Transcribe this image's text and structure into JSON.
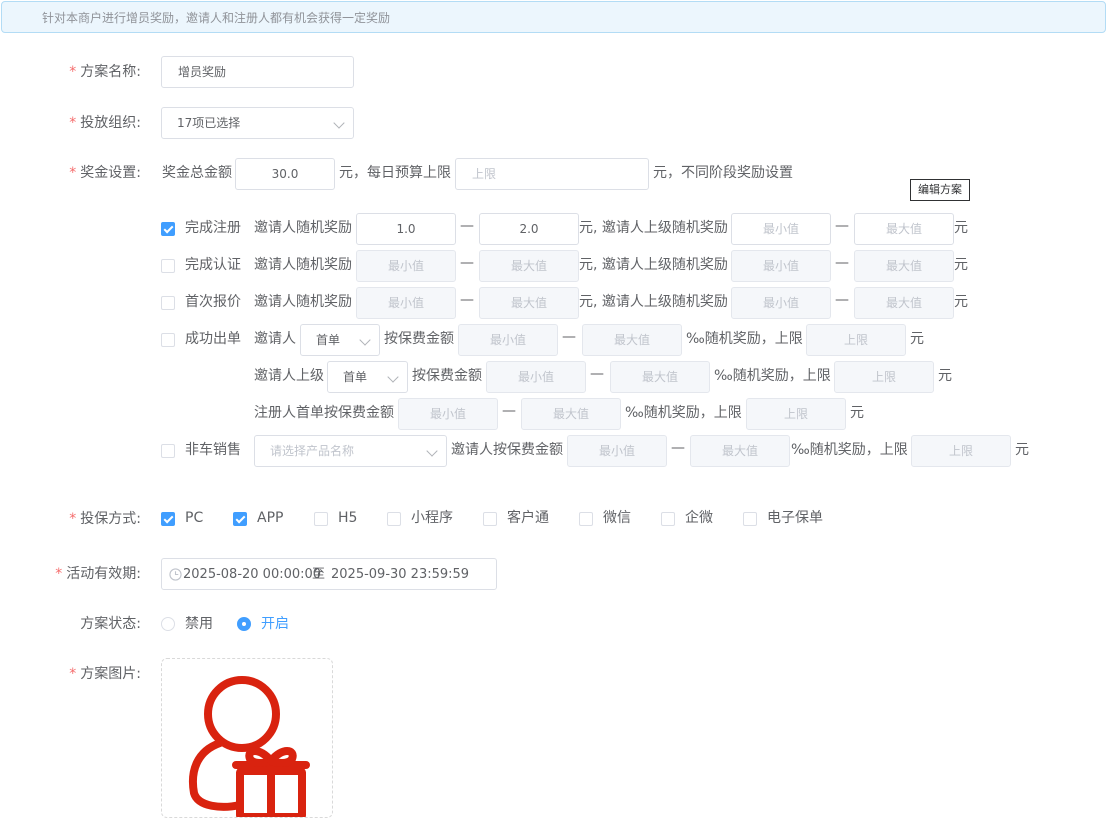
{
  "banner": "针对本商户进行增员奖励，邀请人和注册人都有机会获得一定奖励",
  "labels": {
    "plan_name": "方案名称:",
    "org": "投放组织:",
    "prize": "奖金设置:",
    "insure_method": "投保方式:",
    "period": "活动有效期:",
    "status": "方案状态:",
    "image": "方案图片:"
  },
  "required_mark": "*",
  "plan_name_value": "增员奖励",
  "org_value": "17项已选择",
  "prize": {
    "total_label": "奖金总金额",
    "total_value": "30.0",
    "daily_text": "元，每日预算上限",
    "daily_placeholder": "上限",
    "after_text": "元，不同阶段奖励设置",
    "tooltip": "编辑方案"
  },
  "common": {
    "dash": "—",
    "yuan": "元",
    "min_ph": "最小值",
    "max_ph": "最大值",
    "limit_ph": "上限",
    "inviter_random": "邀请人随机奖励",
    "yuan_superior_random": "元, 邀请人上级随机奖励",
    "by_premium": "按保费金额",
    "permil_random": "‰随机奖励，上限"
  },
  "stages": [
    {
      "label": "完成注册",
      "checked": true,
      "v1": "1.0",
      "v2": "2.0"
    },
    {
      "label": "完成认证",
      "checked": false
    },
    {
      "label": "首次报价",
      "checked": false
    }
  ],
  "deal": {
    "label": "成功出单",
    "inviter": "邀请人",
    "inviter_superior": "邀请人上级",
    "registrant": "注册人首单按保费金额",
    "select_value": "首单"
  },
  "nonauto": {
    "label": "非车销售",
    "select_placeholder": "请选择产品名称",
    "inviter_by_premium": "邀请人按保费金额"
  },
  "channels": [
    {
      "label": "PC",
      "checked": true
    },
    {
      "label": "APP",
      "checked": true
    },
    {
      "label": "H5",
      "checked": false
    },
    {
      "label": "小程序",
      "checked": false
    },
    {
      "label": "客户通",
      "checked": false
    },
    {
      "label": "微信",
      "checked": false
    },
    {
      "label": "企微",
      "checked": false
    },
    {
      "label": "电子保单",
      "checked": false
    }
  ],
  "period": {
    "start": "2025-08-20 00:00:00",
    "sep": "至",
    "end": "2025-09-30 23:59:59",
    "icon": "clock-icon"
  },
  "status_options": [
    {
      "label": "禁用",
      "selected": false
    },
    {
      "label": "开启",
      "selected": true
    }
  ],
  "colors": {
    "primary": "#409eff",
    "required": "#f56c6c",
    "icon_red": "#d9230f"
  }
}
